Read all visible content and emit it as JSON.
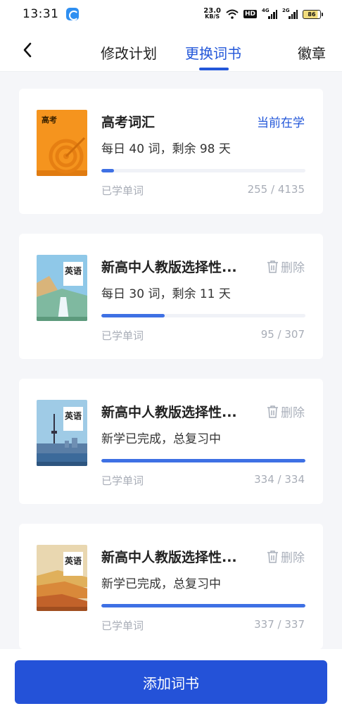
{
  "status_bar": {
    "time": "13:31",
    "net_speed_value": "23.0",
    "net_speed_unit": "KB/S",
    "hd_label": "HD",
    "signal_1_label": "4G",
    "signal_2_label": "2G",
    "battery": "86"
  },
  "nav": {
    "tabs": [
      {
        "label": "修改计划"
      },
      {
        "label": "更换词书"
      }
    ],
    "badge_label": "徽章",
    "active_tab": 1
  },
  "books": [
    {
      "title": "高考词汇",
      "subtitle": "每日 40 词，剩余 98 天",
      "action": "当前在学",
      "learned_label": "已学单词",
      "count": "255 / 4135",
      "progress": 0.062,
      "cover_label": "高考"
    },
    {
      "title": "新高中人教版选择性...",
      "subtitle": "每日 30 词，剩余 11 天",
      "action": "删除",
      "learned_label": "已学单词",
      "count": "95 / 307",
      "progress": 0.309,
      "cover_label": "英语"
    },
    {
      "title": "新高中人教版选择性...",
      "subtitle": "新学已完成，总复习中",
      "action": "删除",
      "learned_label": "已学单词",
      "count": "334 / 334",
      "progress": 1.0,
      "cover_label": "英语"
    },
    {
      "title": "新高中人教版选择性...",
      "subtitle": "新学已完成，总复习中",
      "action": "删除",
      "learned_label": "已学单词",
      "count": "337 / 337",
      "progress": 1.0,
      "cover_label": "英语"
    }
  ],
  "bottom": {
    "add_button": "添加词书"
  },
  "colors": {
    "accent": "#2357d9",
    "button": "#2452d8",
    "progress": "#3e70e4"
  }
}
